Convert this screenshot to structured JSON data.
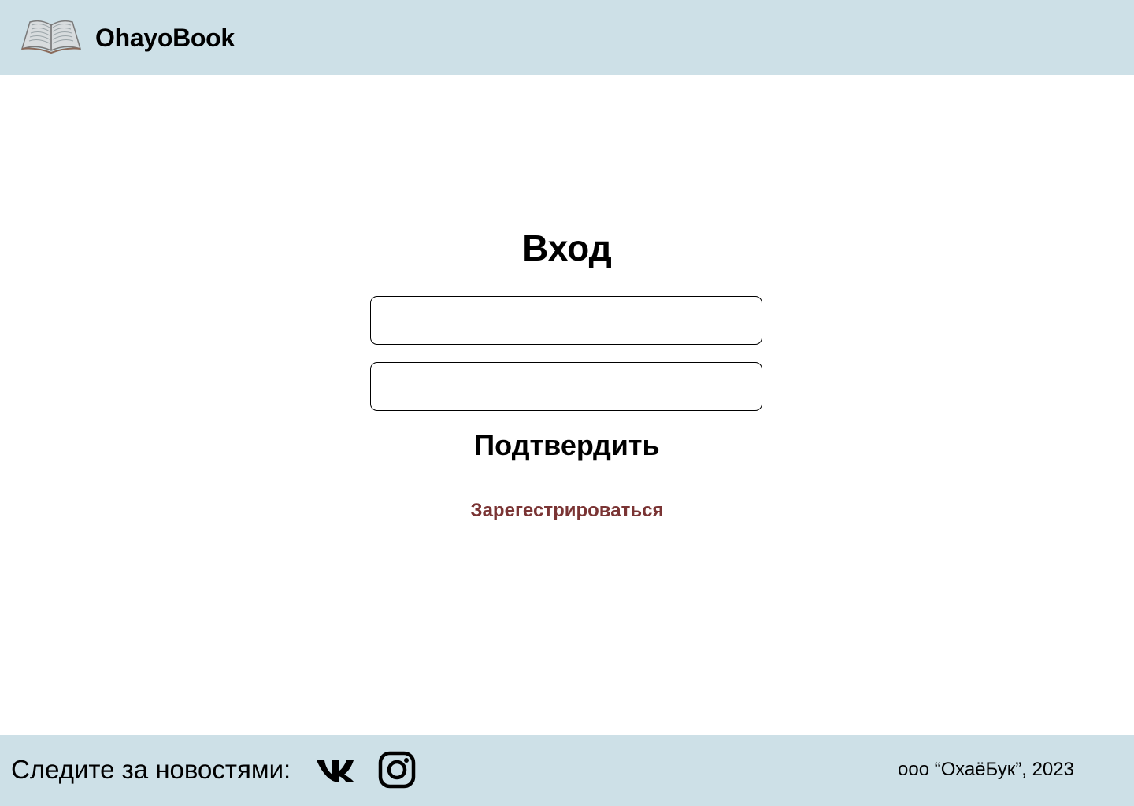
{
  "header": {
    "brand": "OhayoBook",
    "logo_icon": "open-book-icon"
  },
  "login": {
    "title": "Вход",
    "login_field": {
      "value": "",
      "placeholder": ""
    },
    "password_field": {
      "value": "",
      "placeholder": ""
    },
    "submit_label": "Подтвердить",
    "register_label": "Зарегестрироваться"
  },
  "footer": {
    "follow_label": "Следите за новостями:",
    "social_icons": [
      "vk-icon",
      "instagram-icon"
    ],
    "copyright": "ооо “ОхаёБук”, 2023"
  },
  "colors": {
    "header_bg": "#cde0e7",
    "footer_bg": "#cde0e7",
    "register_link": "#7a3434",
    "text": "#000000"
  }
}
